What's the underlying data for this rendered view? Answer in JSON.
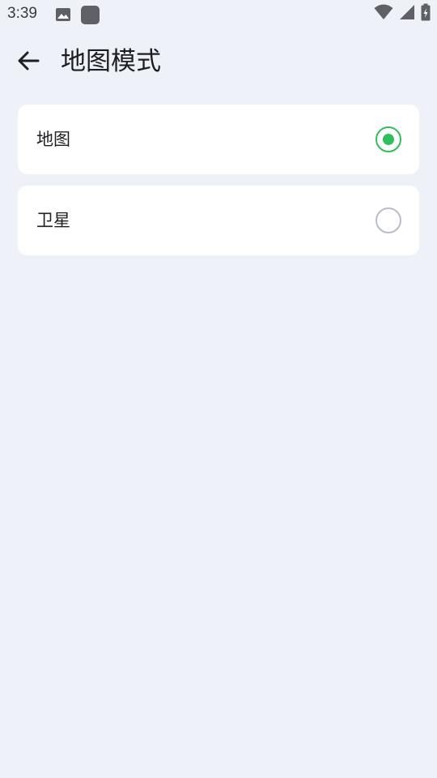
{
  "status_bar": {
    "time": "3:39",
    "icons": [
      "gallery-icon",
      "app-icon",
      "wifi-icon",
      "signal-icon",
      "battery-icon"
    ]
  },
  "app_bar": {
    "back_icon": "arrow-left-icon",
    "title": "地图模式"
  },
  "options": [
    {
      "label": "地图",
      "selected": true
    },
    {
      "label": "卫星",
      "selected": false
    }
  ],
  "colors": {
    "background": "#eef1f8",
    "card": "#ffffff",
    "accent": "#2fbf5b",
    "radio_off": "#b9bcc9"
  }
}
